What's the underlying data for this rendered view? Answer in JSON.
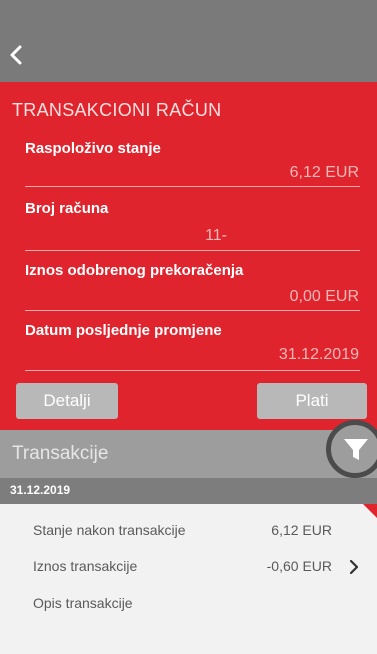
{
  "nav": {
    "back_icon": "chevron-left-icon"
  },
  "account": {
    "title": "TRANSAKCIONI RAČUN",
    "fields": [
      {
        "label": "Raspoloživo stanje",
        "value": "6,12 EUR"
      },
      {
        "label": "Broj računa",
        "value": "11-"
      },
      {
        "label": "Iznos odobrenog prekoračenja",
        "value": "0,00 EUR"
      },
      {
        "label": "Datum posljednje promjene",
        "value": "31.12.2019"
      }
    ],
    "details_button": "Detalji",
    "pay_button": "Plati"
  },
  "transactions": {
    "title": "Transakcije",
    "filter_icon": "filter-icon",
    "groups": [
      {
        "date": "31.12.2019",
        "items": [
          {
            "balance_label": "Stanje nakon transakcije",
            "balance_value": "6,12 EUR",
            "amount_label": "Iznos transakcije",
            "amount_value": "-0,60 EUR",
            "description_label": "Opis transakcije"
          }
        ]
      }
    ]
  },
  "colors": {
    "accent_red": "#e0242d",
    "header_gray": "#7a7a7a"
  }
}
